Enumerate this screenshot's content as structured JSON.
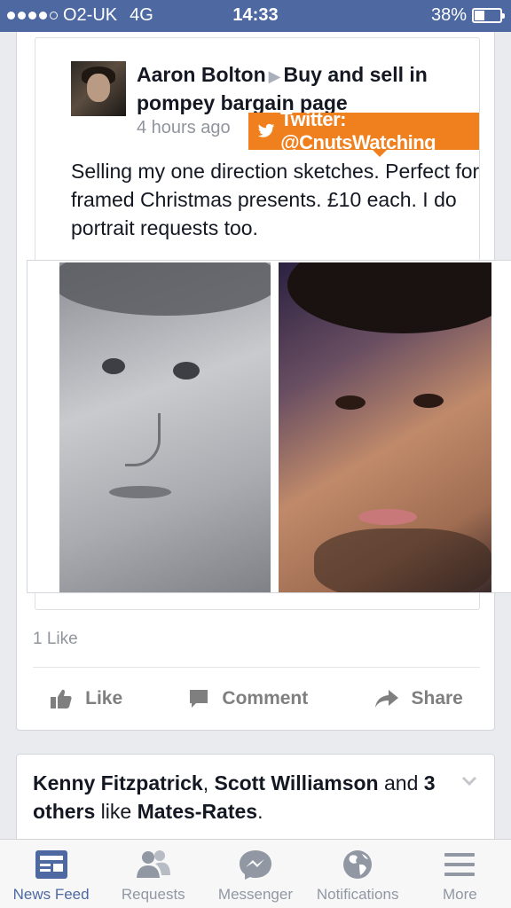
{
  "status_bar": {
    "carrier": "O2-UK",
    "network": "4G",
    "time": "14:33",
    "battery": "38%",
    "battery_level": 0.38
  },
  "post": {
    "author": "Aaron Bolton",
    "group": "Buy and sell in pompey bargain page",
    "timestamp": "4 hours ago",
    "watermark": "Twitter: @CnutsWatching",
    "text": "Selling my one direction sketches. Perfect for framed Christmas presents. £10 each. I do portrait requests too.",
    "like_count": "1 Like",
    "actions": {
      "like": "Like",
      "comment": "Comment",
      "share": "Share"
    }
  },
  "story": {
    "person1": "Kenny Fitzpatrick",
    "sep1": ", ",
    "person2": "Scott Williamson",
    "and": " and ",
    "others": "3 others",
    "like_text": " like ",
    "page": "Mates-Rates",
    "end": "."
  },
  "tabs": [
    {
      "label": "News Feed",
      "icon": "news-feed-icon"
    },
    {
      "label": "Requests",
      "icon": "requests-icon"
    },
    {
      "label": "Messenger",
      "icon": "messenger-icon"
    },
    {
      "label": "Notifications",
      "icon": "globe-icon"
    },
    {
      "label": "More",
      "icon": "menu-icon"
    }
  ],
  "colors": {
    "status_bar": "#4e69a2",
    "active_tab": "#4e69a2",
    "watermark": "#f07f1d"
  }
}
